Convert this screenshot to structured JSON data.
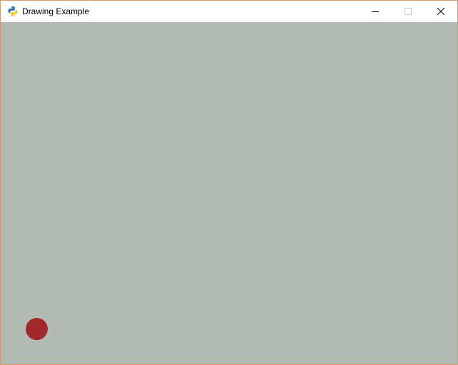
{
  "window": {
    "title": "Drawing Example",
    "border_color": "#d89a6a",
    "app_icon": "python-icon",
    "controls": {
      "minimize_icon": "minimize-icon",
      "maximize_icon": "maximize-icon",
      "close_icon": "close-icon"
    }
  },
  "canvas": {
    "background_color": "#b2bbb3",
    "ball": {
      "shape": "circle",
      "color": "#a1292b"
    }
  }
}
